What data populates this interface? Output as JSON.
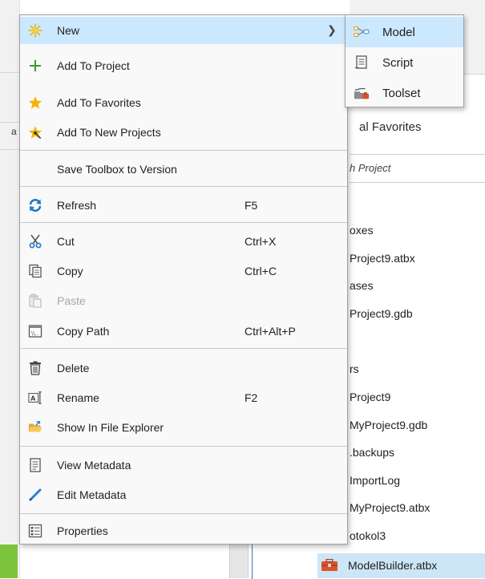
{
  "menu": {
    "new_label": "New",
    "add_to_project": "Add To Project",
    "add_to_favorites": "Add To Favorites",
    "add_to_new_projects": "Add To New Projects",
    "save_toolbox_to_version": "Save Toolbox to Version",
    "refresh": {
      "label": "Refresh",
      "shortcut": "F5"
    },
    "cut": {
      "label": "Cut",
      "shortcut": "Ctrl+X"
    },
    "copy": {
      "label": "Copy",
      "shortcut": "Ctrl+C"
    },
    "paste": "Paste",
    "copy_path": {
      "label": "Copy Path",
      "shortcut": "Ctrl+Alt+P"
    },
    "delete": "Delete",
    "rename": {
      "label": "Rename",
      "shortcut": "F2"
    },
    "show_in_file_explorer": "Show In File Explorer",
    "view_metadata": "View Metadata",
    "edit_metadata": "Edit Metadata",
    "properties": "Properties"
  },
  "submenu": {
    "model": "Model",
    "script": "Script",
    "toolset": "Toolset"
  },
  "background": {
    "tab_favorites": "al  Favorites",
    "search_placeholder": "h Project",
    "tree": [
      "oxes",
      "Project9.atbx",
      "ases",
      "Project9.gdb",
      "rs",
      "Project9",
      "MyProject9.gdb",
      ".backups",
      "ImportLog",
      "MyProject9.atbx",
      "otokol3"
    ],
    "selected_item": "ModelBuilder.atbx",
    "left_fragment": "a"
  },
  "colors": {
    "highlight": "#cce8ff",
    "accent_blue": "#2a7ac5",
    "star_yellow": "#f5b400",
    "green_bar": "#7cc43c"
  }
}
